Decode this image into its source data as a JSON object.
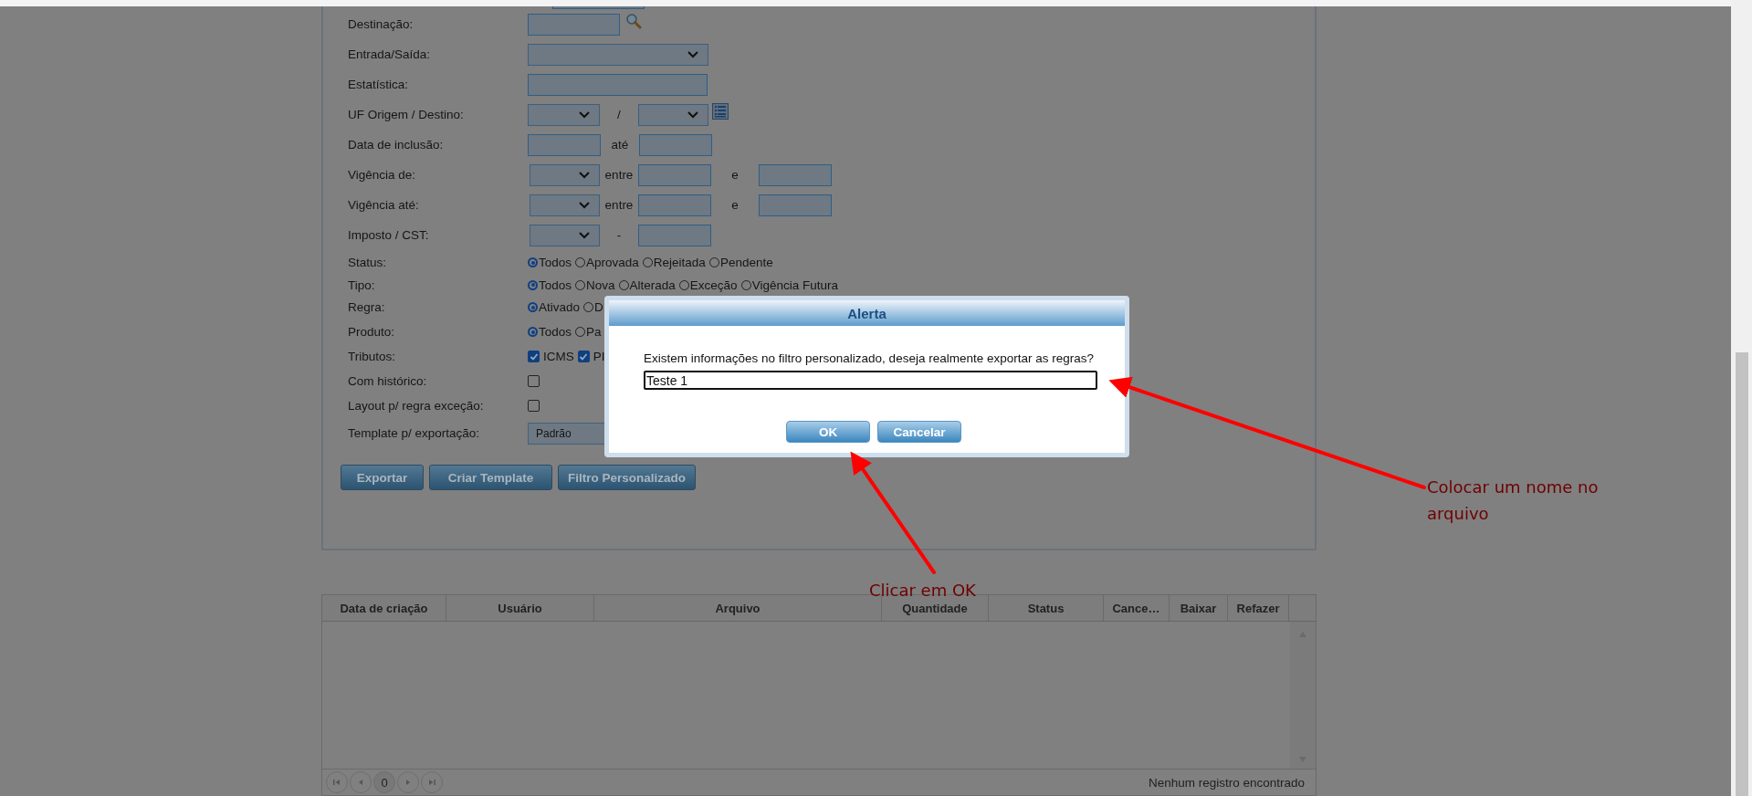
{
  "form": {
    "rows": [
      {
        "kind": "lookup",
        "label": "Destinação:"
      },
      {
        "kind": "select",
        "label": "Entrada/Saída:"
      },
      {
        "kind": "text",
        "label": "Estatística:"
      },
      {
        "kind": "select_pair",
        "label": "UF Origem / Destino:",
        "separator": "/"
      },
      {
        "kind": "text_pair",
        "label": "Data de inclusão:",
        "separator": "até"
      },
      {
        "kind": "select_range",
        "label": "Vigência de:",
        "between": "entre",
        "and": "e"
      },
      {
        "kind": "select_range",
        "label": "Vigência até:",
        "between": "entre",
        "and": "e"
      },
      {
        "kind": "select_text",
        "label": "Imposto / CST:",
        "separator": "-"
      },
      {
        "kind": "radios",
        "label": "Status:",
        "options": [
          {
            "label": "Todos",
            "selected": true
          },
          {
            "label": "Aprovada",
            "selected": false
          },
          {
            "label": "Rejeitada",
            "selected": false
          },
          {
            "label": "Pendente",
            "selected": false
          }
        ]
      },
      {
        "kind": "radios",
        "label": "Tipo:",
        "options": [
          {
            "label": "Todos",
            "selected": true
          },
          {
            "label": "Nova",
            "selected": false
          },
          {
            "label": "Alterada",
            "selected": false
          },
          {
            "label": "Exceção",
            "selected": false
          },
          {
            "label": "Vigência Futura",
            "selected": false
          }
        ]
      },
      {
        "kind": "radios",
        "label": "Regra:",
        "options": [
          {
            "label": "Ativado",
            "selected": true
          },
          {
            "label": "D",
            "selected": false
          }
        ]
      },
      {
        "kind": "radios",
        "label": "Produto:",
        "options": [
          {
            "label": "Todos",
            "selected": true
          },
          {
            "label": "Pa",
            "selected": false
          }
        ]
      },
      {
        "kind": "checks",
        "label": "Tributos:",
        "options": [
          {
            "label": "ICMS",
            "checked": true
          },
          {
            "label": "PI",
            "checked": true
          }
        ]
      },
      {
        "kind": "checkbox",
        "label": "Com histórico:",
        "checked": false
      },
      {
        "kind": "checkbox",
        "label": "Layout p/ regra exceção:",
        "checked": false
      },
      {
        "kind": "value_select",
        "label": "Template p/ exportação:",
        "value": "Padrão"
      }
    ],
    "buttons": [
      "Exportar",
      "Criar Template",
      "Filtro Personalizado"
    ]
  },
  "table": {
    "columns": [
      "Data de criação",
      "Usuário",
      "Arquivo",
      "Quantidade",
      "Status",
      "Cance…",
      "Baixar",
      "Refazer"
    ],
    "page": "0",
    "status": "Nenhum registro encontrado"
  },
  "dialog": {
    "title": "Alerta",
    "message": "Existem informações no filtro personalizado, deseja realmente exportar as regras?",
    "value": "Teste 1",
    "buttons": [
      "OK",
      "Cancelar"
    ]
  },
  "annotations": [
    {
      "text": "Colocar um nome no arquivo"
    },
    {
      "text": "Clicar em OK"
    }
  ]
}
